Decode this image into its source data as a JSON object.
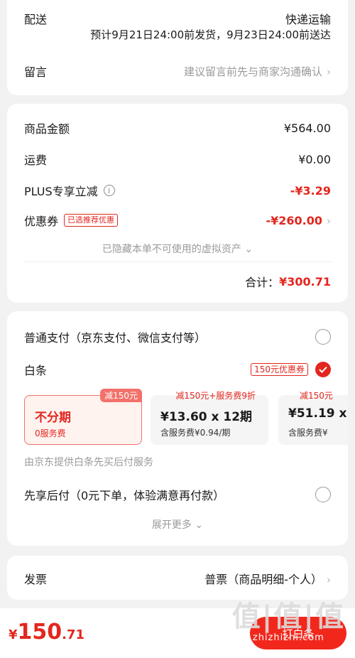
{
  "delivery": {
    "label": "配送",
    "method": "快递运输",
    "estimate": "预计9月21日24:00前发货，9月23日24:00前送达"
  },
  "message": {
    "label": "留言",
    "placeholder": "建议留言前先与商家沟通确认"
  },
  "summary": {
    "goods_label": "商品金额",
    "goods_value": "¥564.00",
    "shipping_label": "运费",
    "shipping_value": "¥0.00",
    "plus_label": "PLUS专享立减",
    "plus_value": "-¥3.29",
    "coupon_label": "优惠券",
    "coupon_tag": "已选推荐优惠",
    "coupon_value": "-¥260.00",
    "hidden_assets": "已隐藏本单不可使用的虚拟资产",
    "total_label": "合计：",
    "total_value": "¥300.71"
  },
  "payment": {
    "normal_label": "普通支付（京东支付、微信支付等）",
    "baitiao_label": "白条",
    "baitiao_tag": "150元优惠券",
    "plans": [
      {
        "badge": "减150元",
        "main": "不分期",
        "sub": "0服务费"
      },
      {
        "badge": "减150元+服务费9折",
        "main": "¥13.60 x 12期",
        "sub": "含服务费¥0.94/期"
      },
      {
        "badge": "减150元",
        "main": "¥51.19 x",
        "sub": "含服务费¥"
      }
    ],
    "baitiao_note": "由京东提供白条先买后付服务",
    "later_label": "先享后付（0元下单，体验满意再付款）",
    "expand_label": "展开更多"
  },
  "invoice": {
    "label": "发票",
    "value": "普票（商品明细-个人）"
  },
  "bottom": {
    "price_symbol": "¥",
    "price_int": "150",
    "price_dec": ".71",
    "pay_label": "打白条",
    "watermark_big": "值|值|值",
    "watermark_small": "zhizhizhi.com"
  },
  "colors": {
    "accent": "#e3261e",
    "background": "#f2f2f2"
  }
}
